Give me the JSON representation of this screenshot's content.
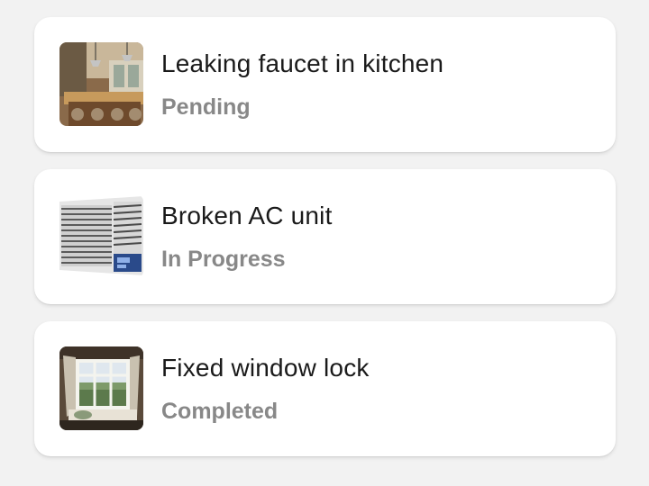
{
  "requests": [
    {
      "title": "Leaking faucet in kitchen",
      "status": "Pending",
      "image_icon": "kitchen-photo-icon"
    },
    {
      "title": "Broken AC unit",
      "status": "In Progress",
      "image_icon": "air-conditioner-photo-icon"
    },
    {
      "title": "Fixed window lock",
      "status": "Completed",
      "image_icon": "window-photo-icon"
    }
  ],
  "colors": {
    "background": "#f2f2f2",
    "card": "#ffffff",
    "title_text": "#1a1a1a",
    "status_text": "#888888"
  }
}
